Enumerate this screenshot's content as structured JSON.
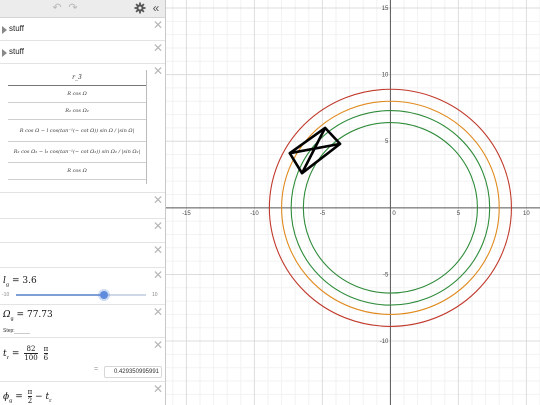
{
  "toolbar": {
    "undo_icon": "undo-arrow-icon",
    "redo_icon": "redo-arrow-icon",
    "settings_icon": "gear-icon",
    "collapse_icon": "double-chevron-left-icon",
    "collapse_glyph": "«"
  },
  "folders": [
    {
      "label": "stuff"
    },
    {
      "label": "stuff"
    }
  ],
  "table": {
    "header": "r_3",
    "rows": [
      "R cos Ω",
      "R₂ cos Ω₂",
      "R cos Ω − l cos(tan⁻¹(− cot Ω)) sin Ω / |sin Ω|",
      "R₂ cos Ω₂ − l₂ cos(tan⁻¹(− cot Ω₂)) sin Ω₂ / |sin Ω₂|",
      "R cos Ω"
    ]
  },
  "expressions": {
    "lg": {
      "symbol": "l",
      "sub": "g",
      "eq": "=",
      "value": "3.6"
    },
    "slider": {
      "min": "-10",
      "max": "10",
      "value": 3.6
    },
    "omega": {
      "symbol": "Ω",
      "sub": "g",
      "eq": "=",
      "value": "77.73"
    },
    "step_label": "Step:",
    "tr": {
      "symbol": "t",
      "sub": "r",
      "eq": "=",
      "num": "82",
      "den": "100",
      "pi_num": "π",
      "pi_den": "6"
    },
    "tr_result": "0.429350995991",
    "tr_result_eq": "=",
    "phi": {
      "symbol": "ϕ",
      "sub": "g",
      "eq": "=",
      "pi_num": "π",
      "pi_den": "2",
      "minus": "−",
      "tail": "t",
      "tail_sub": "r"
    }
  },
  "graph": {
    "x_range": [
      -16.5,
      11.0
    ],
    "y_range": [
      -14.8,
      15.6
    ],
    "x_ticks": [
      -15,
      -10,
      -5,
      0,
      5,
      10
    ],
    "y_ticks": [
      15,
      10,
      5,
      -5,
      -10
    ],
    "x_tick_labels": [
      "-15",
      "-10",
      "-5",
      "0",
      "5",
      "10"
    ],
    "y_tick_labels": [
      "15",
      "10",
      "5",
      "-5",
      "-10"
    ],
    "minor_step": 1,
    "colors": {
      "grid_minor": "#f2f2f2",
      "grid_major": "#dcdcdc",
      "axis": "#555555",
      "circle_red": "#c0392b",
      "circle_orange": "#e08a1e",
      "circle_green": "#2e8b3a",
      "box": "#000000"
    },
    "circles": [
      {
        "name": "red",
        "r": 8.9
      },
      {
        "name": "orange",
        "r": 8.0
      },
      {
        "name": "green-outer",
        "r": 7.3
      },
      {
        "name": "green-inner",
        "r": 6.4
      }
    ],
    "box": [
      [
        -7.4,
        4.1
      ],
      [
        -4.8,
        6.0
      ],
      [
        -3.7,
        4.8
      ],
      [
        -6.5,
        2.6
      ]
    ]
  }
}
